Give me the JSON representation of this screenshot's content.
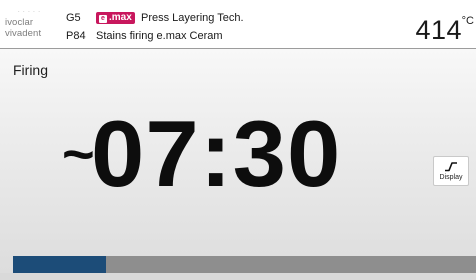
{
  "header": {
    "logo": {
      "dots": "· · · · ·",
      "line1": "ivoclar",
      "line2": "vivadent"
    },
    "group_code": "G5",
    "brand_badge": "e.max",
    "layering_title": "Press Layering Tech.",
    "program_code": "P84",
    "program_name": "Stains firing e.max Ceram",
    "temperature": "414",
    "temperature_unit": "°C"
  },
  "main": {
    "status": "Firing",
    "timer_prefix": "~",
    "timer_value": "07:30",
    "display_button_label": "Display",
    "progress_fraction": 0.2
  },
  "colors": {
    "brand_badge": "#c8175d",
    "progress_fill": "#1c4c78",
    "progress_track": "#8e8e8e"
  },
  "icons": {
    "display": "step-curve-icon"
  }
}
